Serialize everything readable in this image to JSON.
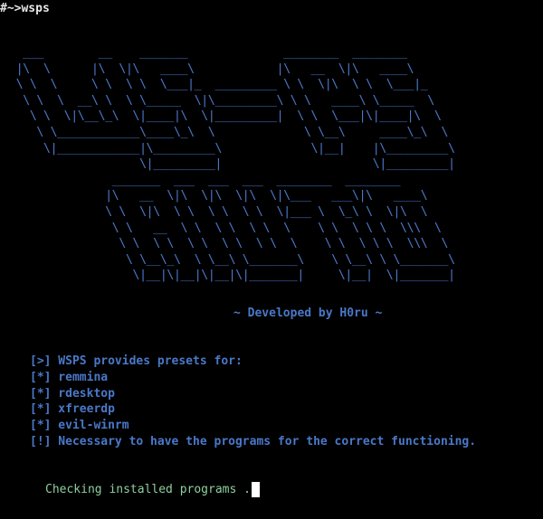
{
  "terminal": {
    "prompt": "#~>wsps",
    "banner_art": "  ___        __    _______              ________  ________\n |\\  \\      |\\  \\|\\   ____\\            |\\   __  \\|\\   ____\\\n \\ \\  \\     \\ \\  \\ \\  \\___|_  _________ \\ \\  \\|\\  \\ \\  \\___|_\n  \\ \\  \\  __\\ \\  \\ \\_____  \\|\\_________\\ \\ \\   ____\\ \\_____  \\\n   \\ \\  \\|\\__\\_\\  \\|____|\\  \\|_________|  \\ \\  \\___|\\|____|\\  \\\n    \\ \\____________\\____\\_\\  \\             \\ \\__\\     ____\\_\\  \\\n     \\|____________|\\_________\\             \\|__|    |\\_________\\\n                   \\|_________|                      \\|_________|\n               _______  ___  ___  ___  ________  ________\n              |\\   __  \\|\\  \\|\\  \\|\\  \\|\\___   ___\\|\\   ____\\\n              \\ \\  \\|\\  \\ \\  \\ \\  \\ \\  \\|___ \\  \\_\\ \\  \\|\\  \\\n               \\ \\   __  \\ \\  \\ \\  \\ \\  \\    \\ \\  \\ \\ \\  \\\\\\  \\\n                \\ \\  \\ \\  \\ \\  \\ \\  \\ \\  \\    \\ \\  \\ \\ \\  \\\\\\  \\\n                 \\ \\__\\_\\  \\ \\__\\ \\_______\\    \\ \\__\\ \\ \\_______\\\n                  \\|__|\\|__|\\|__|\\|_______|     \\|__|  \\|_______|",
    "credit": "~ Developed by H0ru ~",
    "info_lines": [
      "[>] WSPS provides presets for:",
      "[*] remmina",
      "[*] rdesktop",
      "[*] xfreerdp",
      "[*] evil-winrm",
      "[!] Necessary to have the programs for the correct functioning."
    ],
    "status": "Checking installed programs ."
  },
  "colors": {
    "background": "#000000",
    "accent_blue": "#4a78c8",
    "status_green": "#8fcfa0",
    "prompt_white": "#e6e6e6",
    "cursor": "#ffffff"
  }
}
